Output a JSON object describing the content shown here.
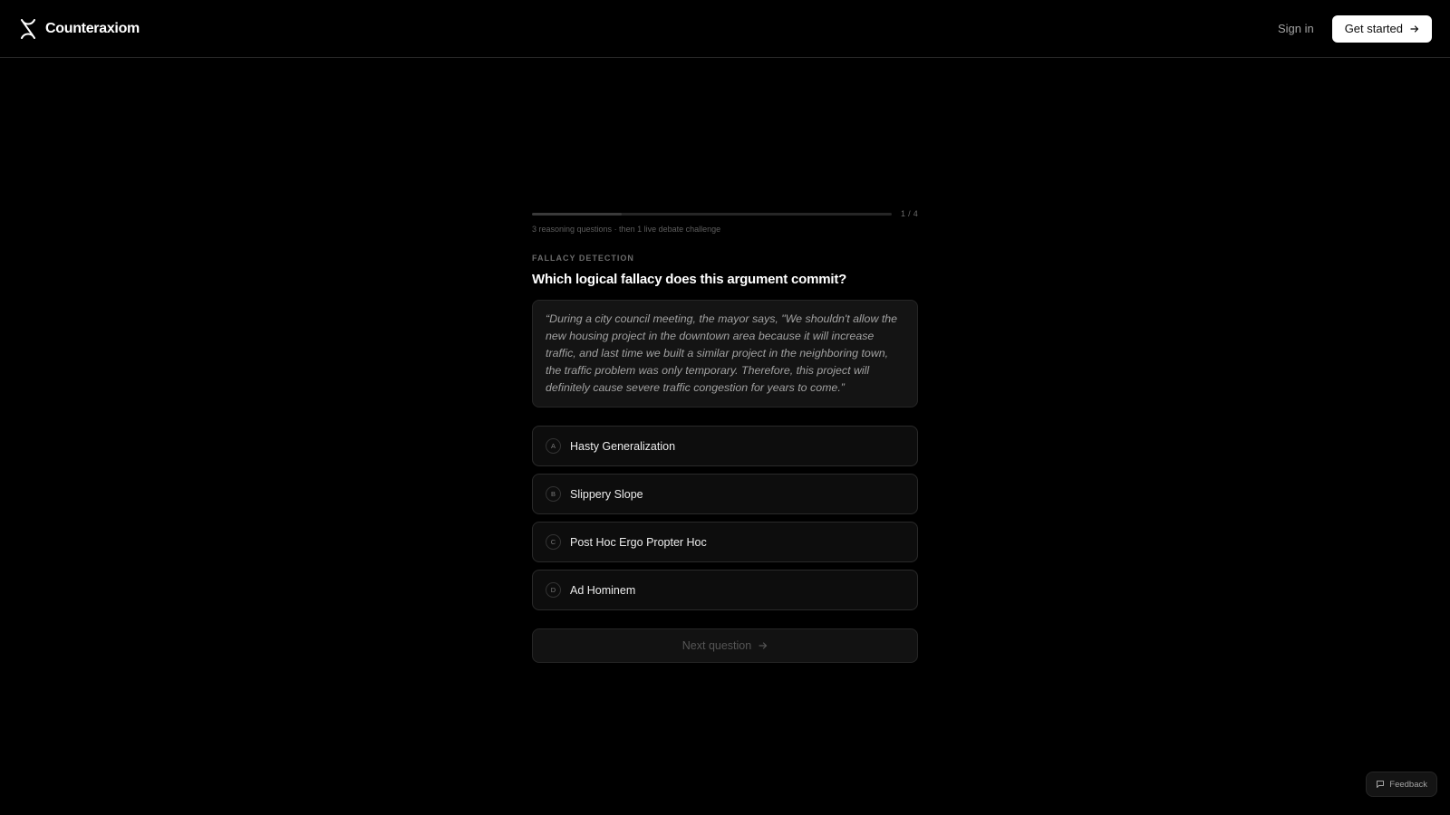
{
  "header": {
    "brand_name": "Counteraxiom",
    "sign_in_label": "Sign in",
    "get_started_label": "Get started"
  },
  "quiz": {
    "progress": {
      "current": 1,
      "total": 4,
      "label": "1 / 4"
    },
    "subtitle": "3 reasoning questions · then 1 live debate challenge",
    "category": "FALLACY DETECTION",
    "question": "Which logical fallacy does this argument commit?",
    "argument": "“During a city council meeting, the mayor says, \"We shouldn't allow the new housing project in the downtown area because it will increase traffic, and last time we built a similar project in the neighboring town, the traffic problem was only temporary. Therefore, this project will definitely cause severe traffic congestion for years to come.”",
    "options": [
      {
        "letter": "A",
        "label": "Hasty Generalization"
      },
      {
        "letter": "B",
        "label": "Slippery Slope"
      },
      {
        "letter": "C",
        "label": "Post Hoc Ergo Propter Hoc"
      },
      {
        "letter": "D",
        "label": "Ad Hominem"
      }
    ],
    "next_label": "Next question"
  },
  "feedback": {
    "label": "Feedback"
  },
  "icons": {
    "logo": "counteraxiom-logo",
    "arrow": "arrow-right-icon",
    "feedback": "message-square-icon"
  },
  "colors": {
    "background": "#000000",
    "primary_button": "#ffffff",
    "card": "#141414",
    "border": "#262626"
  }
}
